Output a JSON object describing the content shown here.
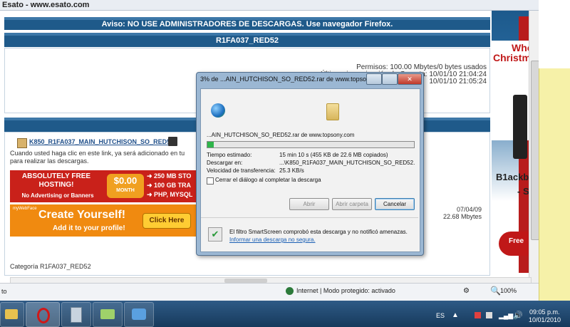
{
  "browser": {
    "title": "Esato - www.esato.com",
    "status_zone": "Internet | Modo protegido: activado",
    "status_left": "to",
    "zoom": "100%"
  },
  "page": {
    "notice": "Aviso: NO USE ADMINISTRADORES DE DESCARGAS. Use navegador Firefox.",
    "folder_title": "R1FA037_RED52",
    "perm_line1": "Permisos: 100.00 Mbytes/0 bytes usados",
    "perm_line2": "Última sincronización de Carpeta: 10/01/10 21:04:24",
    "perm_line3": "10/01/10 21:05:24",
    "file_link": "K850_R1FA037_MAIN_HUTCHISON_SO_RED52",
    "file_desc1": "Cuando usted haga clic en este link, ya será adicionado en tu",
    "file_desc2": "para realizar las descargas.",
    "file_date": "07/04/09",
    "file_size": "22.68 Mbytes",
    "category": "Categoría R1FA037_RED52"
  },
  "ads": {
    "ad1_line1": "ABSOLUTELY FREE",
    "ad1_line2": "HOSTING!",
    "ad1_line3": "No Advertising or Banners",
    "ad1_price": "$0.00",
    "ad1_month": "MONTH",
    "ad1_f1": "250 MB STO",
    "ad1_f2": "100 GB TRA",
    "ad1_f3": "PHP, MYSQL",
    "ad2_brand": "myWebFace",
    "ad2_title": "Create Yourself!",
    "ad2_sub": "Add it to your profile!",
    "ad2_button": "Click Here",
    "side_l1": "Who",
    "side_l2": "Christm",
    "side_l3": "B1ackb",
    "side_l4": "- S",
    "side_l5": "Free"
  },
  "dialog": {
    "title": "3% de ...AIN_HUTCHISON_SO_RED52.rar de www.topson...",
    "filename": "...AIN_HUTCHISON_SO_RED52.rar de www.topsony.com",
    "progress": 0.03,
    "est_label": "Tiempo estimado:",
    "est_value": "15 min 10 s (455 KB de 22.6 MB copiados)",
    "dest_label": "Descargar en:",
    "dest_value": "...\\K850_R1FA037_MAIN_HUTCHISON_SO_RED52.",
    "speed_label": "Velocidad de transferencia:",
    "speed_value": "25.3 KB/s",
    "close_check": "Cerrar el diálogo al completar la descarga",
    "btn_open": "Abrir",
    "btn_folder": "Abrir carpeta",
    "btn_cancel": "Cancelar",
    "smartscreen": "El filtro SmartScreen comprobó esta descarga y no notificó amenazas.",
    "report_link": "Informar una descarga no segura."
  },
  "taskbar": {
    "lang": "ES",
    "time": "09:05 p.m.",
    "date": "10/01/2010"
  }
}
